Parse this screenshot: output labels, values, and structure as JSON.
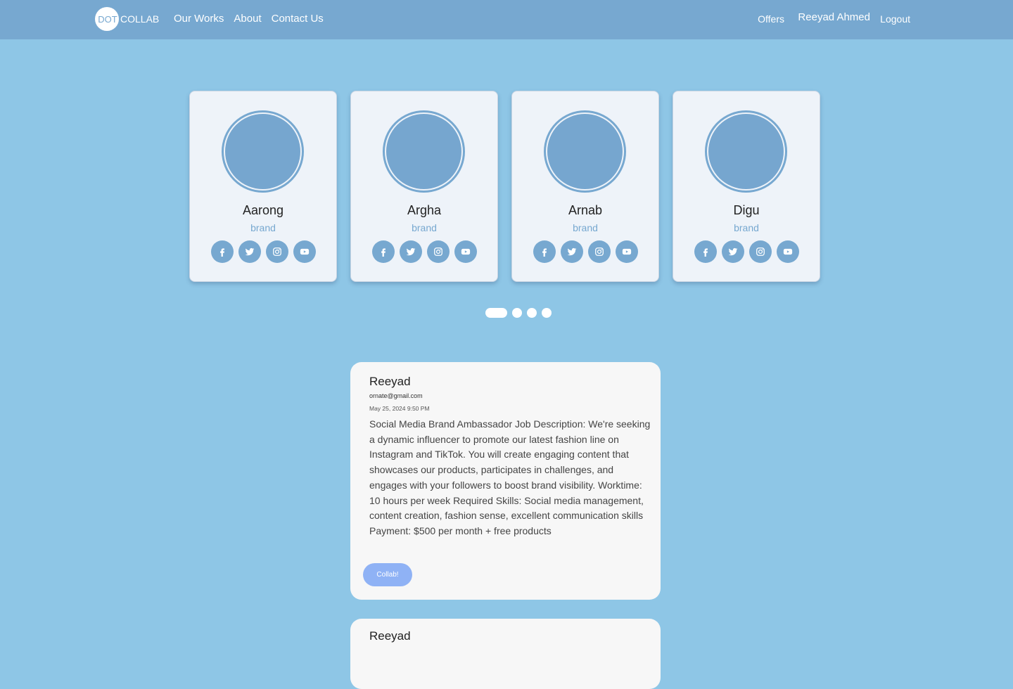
{
  "nav": {
    "logo_dot": "DOT",
    "logo_collab": "COLLAB",
    "links": [
      "Our Works",
      "About",
      "Contact Us"
    ],
    "offers": "Offers",
    "user": "Reeyad Ahmed",
    "logout": "Logout"
  },
  "cards": [
    {
      "name": "Aarong",
      "role": "brand"
    },
    {
      "name": "Argha",
      "role": "brand"
    },
    {
      "name": "Arnab",
      "role": "brand"
    },
    {
      "name": "Digu",
      "role": "brand"
    }
  ],
  "social_icons": [
    "facebook-icon",
    "twitter-icon",
    "instagram-icon",
    "youtube-icon"
  ],
  "carousel": {
    "slides": 4,
    "active": 0
  },
  "post": {
    "author": "Reeyad",
    "email": "ornate@gmail.com",
    "date": "May 25, 2024 9:50 PM",
    "body": "Social Media Brand Ambassador Job Description: We're seeking a dynamic influencer to promote our latest fashion line on Instagram and TikTok. You will create engaging content that showcases our products, participates in challenges, and engages with your followers to boost brand visibility. Worktime: 10 hours per week Required Skills: Social media management, content creation, fashion sense, excellent communication skills Payment: $500 per month + free products",
    "button": "Collab!"
  },
  "post2": {
    "author": "Reeyad"
  },
  "colors": {
    "background": "#8ec6e6",
    "navbar": "#77a8d0",
    "card": "#eef3f9",
    "accent": "#77a8d0",
    "button": "#8fb2f5"
  }
}
